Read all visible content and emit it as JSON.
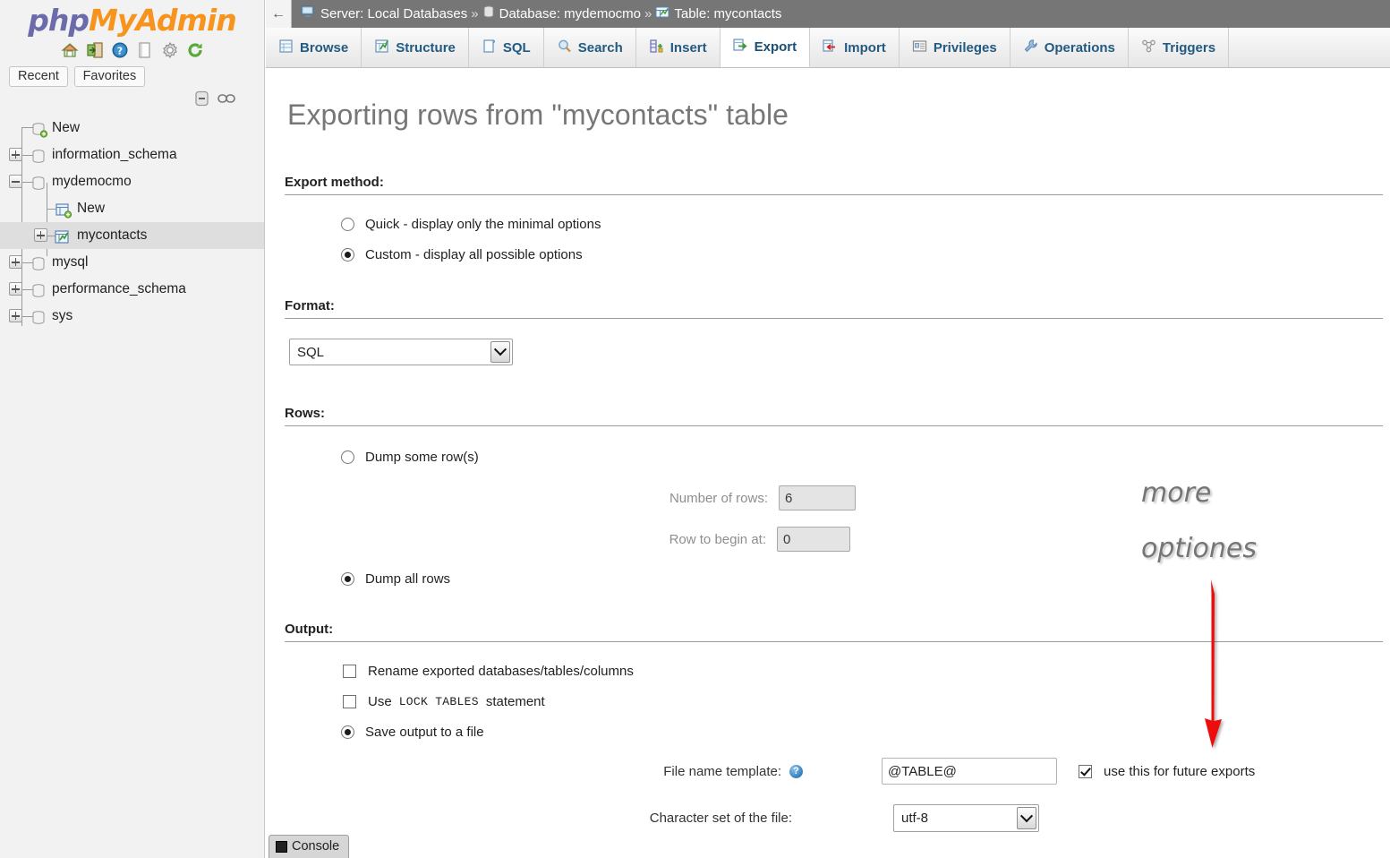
{
  "app": {
    "logo_primary": "php",
    "logo_secondary": "MyAdmin"
  },
  "sidebar": {
    "header_icons": [
      {
        "name": "home-icon",
        "title": "Home"
      },
      {
        "name": "logout-icon",
        "title": "Log out"
      },
      {
        "name": "help-icon",
        "title": "phpMyAdmin documentation"
      },
      {
        "name": "documentation-icon",
        "title": "Documentation"
      },
      {
        "name": "settings-icon",
        "title": "Settings"
      },
      {
        "name": "reload-icon",
        "title": "Reload navigation"
      }
    ],
    "quick_buttons": [
      {
        "label": "Recent"
      },
      {
        "label": "Favorites"
      }
    ],
    "tree_tools": [
      {
        "name": "collapse-all-icon"
      },
      {
        "name": "link-with-main-panel-icon"
      }
    ],
    "tree": [
      {
        "label": "New",
        "icon": "new-database-icon",
        "indent": 0,
        "toggle": "none",
        "selected": false
      },
      {
        "label": "information_schema",
        "icon": "database-icon",
        "indent": 0,
        "toggle": "plus",
        "selected": false
      },
      {
        "label": "mydemocmo",
        "icon": "database-icon",
        "indent": 0,
        "toggle": "minus",
        "selected": false
      },
      {
        "label": "New",
        "icon": "new-table-icon",
        "indent": 1,
        "toggle": "none",
        "selected": false
      },
      {
        "label": "mycontacts",
        "icon": "table-icon",
        "indent": 1,
        "toggle": "plus",
        "selected": true
      },
      {
        "label": "mysql",
        "icon": "database-icon",
        "indent": 0,
        "toggle": "plus",
        "selected": false
      },
      {
        "label": "performance_schema",
        "icon": "database-icon",
        "indent": 0,
        "toggle": "plus",
        "selected": false
      },
      {
        "label": "sys",
        "icon": "database-icon",
        "indent": 0,
        "toggle": "plus",
        "selected": false
      }
    ]
  },
  "breadcrumb": {
    "back_glyph": "←",
    "server_label": "Server: Local Databases",
    "database_label": "Database: mydemocmo",
    "table_label": "Table: mycontacts",
    "separator": "»"
  },
  "tabs": [
    {
      "label": "Browse",
      "icon": "browse-icon",
      "active": false
    },
    {
      "label": "Structure",
      "icon": "structure-icon",
      "active": false
    },
    {
      "label": "SQL",
      "icon": "sql-icon",
      "active": false
    },
    {
      "label": "Search",
      "icon": "search-icon",
      "active": false
    },
    {
      "label": "Insert",
      "icon": "insert-icon",
      "active": false
    },
    {
      "label": "Export",
      "icon": "export-icon",
      "active": true
    },
    {
      "label": "Import",
      "icon": "import-icon",
      "active": false
    },
    {
      "label": "Privileges",
      "icon": "privileges-icon",
      "active": false
    },
    {
      "label": "Operations",
      "icon": "operations-icon",
      "active": false
    },
    {
      "label": "Triggers",
      "icon": "triggers-icon",
      "active": false
    }
  ],
  "page": {
    "title": "Exporting rows from \"mycontacts\" table"
  },
  "export_method": {
    "heading": "Export method:",
    "options": [
      {
        "label": "Quick - display only the minimal options",
        "selected": false
      },
      {
        "label": "Custom - display all possible options",
        "selected": true
      }
    ]
  },
  "format": {
    "heading": "Format:",
    "selected": "SQL"
  },
  "rows": {
    "heading": "Rows:",
    "dump_some_label": "Dump some row(s)",
    "dump_some_selected": false,
    "number_of_rows_label": "Number of rows:",
    "number_of_rows_value": "6",
    "row_to_begin_label": "Row to begin at:",
    "row_to_begin_value": "0",
    "dump_all_label": "Dump all rows",
    "dump_all_selected": true
  },
  "output": {
    "heading": "Output:",
    "rename_label": "Rename exported databases/tables/columns",
    "rename_checked": false,
    "lock_prefix": "Use",
    "lock_mono": "LOCK TABLES",
    "lock_suffix": "statement",
    "lock_checked": false,
    "save_to_file_label": "Save output to a file",
    "save_to_file_selected": true,
    "file_name_template_label": "File name template:",
    "file_name_template_value": "@TABLE@",
    "future_exports_label": "use this for future exports",
    "future_exports_checked": true,
    "charset_label": "Character set of the file:",
    "charset_value": "utf-8"
  },
  "annotation": {
    "line1": "more",
    "line2": "optiones",
    "arrow_color": "#ee1111"
  },
  "console": {
    "label": "Console"
  }
}
